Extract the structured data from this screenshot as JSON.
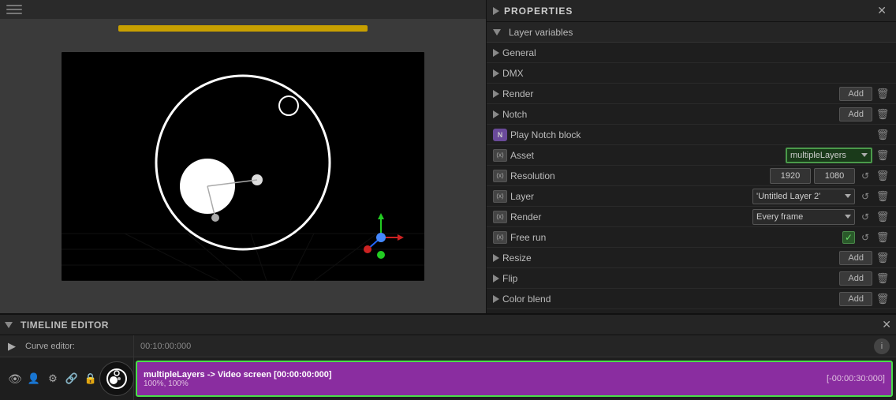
{
  "viewport": {
    "toolbar_lines": 3
  },
  "properties": {
    "panel_title": "PROPERTIES",
    "close_label": "✕",
    "section_title": "Layer variables",
    "rows": [
      {
        "id": "general",
        "type": "play",
        "label": "General",
        "has_add": false,
        "has_delete": false
      },
      {
        "id": "dmx",
        "type": "play",
        "label": "DMX",
        "has_add": false,
        "has_delete": false
      },
      {
        "id": "render1",
        "type": "play",
        "label": "Render",
        "has_add": true,
        "has_delete": true
      },
      {
        "id": "notch",
        "type": "play",
        "label": "Notch",
        "has_add": true,
        "has_delete": true
      },
      {
        "id": "play-notch-block",
        "type": "notch-icon",
        "label": "Play Notch block",
        "has_add": false,
        "has_delete": true
      },
      {
        "id": "asset",
        "type": "xy",
        "label": "Asset",
        "has_select": true,
        "select_value": "multipleLayers",
        "has_delete": true
      },
      {
        "id": "resolution",
        "type": "xy",
        "label": "Resolution",
        "has_nums": true,
        "num1": "1920",
        "num2": "1080",
        "has_reset": true,
        "has_delete": true
      },
      {
        "id": "layer",
        "type": "xy",
        "label": "Layer",
        "has_selectbox": true,
        "selectbox_value": "'Untitled Layer 2'",
        "has_reset": true,
        "has_delete": true
      },
      {
        "id": "render2",
        "type": "xy",
        "label": "Render",
        "has_selectbox": true,
        "selectbox_value": "Every frame",
        "has_reset": true,
        "has_delete": true
      },
      {
        "id": "freerun",
        "type": "xy",
        "label": "Free run",
        "has_checkbox": true,
        "has_reset": true,
        "has_delete": true
      },
      {
        "id": "resize",
        "type": "play",
        "label": "Resize",
        "has_add": true,
        "has_delete": true
      },
      {
        "id": "flip",
        "type": "play",
        "label": "Flip",
        "has_add": true,
        "has_delete": true
      },
      {
        "id": "colorblend",
        "type": "play",
        "label": "Color blend",
        "has_add": true,
        "has_delete": true
      }
    ]
  },
  "timeline": {
    "panel_title": "TIMELINE EDITOR",
    "close_label": "✕",
    "curve_editor_label": "Curve editor:",
    "ruler_time": "00:10:00:000",
    "info_btn": "i",
    "clip": {
      "title": "multipleLayers -> Video screen  [00:00:00:000]",
      "subtitle": "100%, 100%",
      "time_right": "[-00:00:30:000]"
    }
  }
}
